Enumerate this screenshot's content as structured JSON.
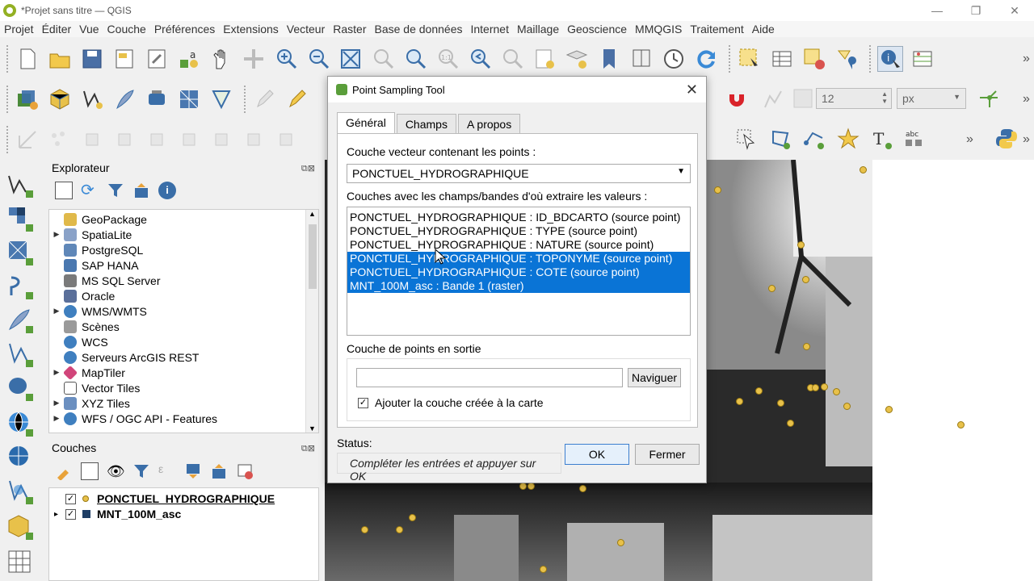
{
  "window": {
    "title": "*Projet sans titre — QGIS",
    "minimize": "—",
    "restore": "❐",
    "close": "✕"
  },
  "menu": [
    "Projet",
    "Éditer",
    "Vue",
    "Couche",
    "Préférences",
    "Extensions",
    "Vecteur",
    "Raster",
    "Base de données",
    "Internet",
    "Maillage",
    "Geoscience",
    "MMQGIS",
    "Traitement",
    "Aide"
  ],
  "toolbar": {
    "spin_value": "12",
    "unit": "px",
    "more": "»"
  },
  "explorer": {
    "title": "Explorateur",
    "items": [
      {
        "label": "GeoPackage",
        "expand": false,
        "color": "#e0b94a"
      },
      {
        "label": "SpatiaLite",
        "expand": true,
        "color": "#8aa2c8"
      },
      {
        "label": "PostgreSQL",
        "expand": false,
        "color": "#5f87b8"
      },
      {
        "label": "SAP HANA",
        "expand": false,
        "color": "#4a78b0"
      },
      {
        "label": "MS SQL Server",
        "expand": false,
        "color": "#7a7a7a"
      },
      {
        "label": "Oracle",
        "expand": false,
        "color": "#5a6f9a"
      },
      {
        "label": "WMS/WMTS",
        "expand": true,
        "color": "#3f7fbf"
      },
      {
        "label": "Scènes",
        "expand": false,
        "color": "#9a9a9a"
      },
      {
        "label": "WCS",
        "expand": false,
        "color": "#3f7fbf"
      },
      {
        "label": "Serveurs ArcGIS REST",
        "expand": false,
        "color": "#3f7fbf"
      },
      {
        "label": "MapTiler",
        "expand": true,
        "color": "#d1457a"
      },
      {
        "label": "Vector Tiles",
        "expand": false,
        "color": "#777777"
      },
      {
        "label": "XYZ Tiles",
        "expand": true,
        "color": "#6b8fc0"
      },
      {
        "label": "WFS / OGC API - Features",
        "expand": true,
        "color": "#3f7fbf"
      }
    ]
  },
  "layers": {
    "title": "Couches",
    "items": [
      {
        "label": "PONCTUEL_HYDROGRAPHIQUE",
        "checked": "✓",
        "expand": ""
      },
      {
        "label": "MNT_100M_asc",
        "checked": "✓",
        "expand": "▸"
      }
    ]
  },
  "dialog": {
    "title": "Point Sampling Tool",
    "close": "✕",
    "tabs": [
      "Général",
      "Champs",
      "A propos"
    ],
    "point_layer_label": "Couche vecteur contenant les points :",
    "point_layer_value": "PONCTUEL_HYDROGRAPHIQUE",
    "fields_label": "Couches avec les champs/bandes d'où extraire les valeurs :",
    "fields": [
      {
        "label": "PONCTUEL_HYDROGRAPHIQUE : ID_BDCARTO (source point)",
        "selected": false
      },
      {
        "label": "PONCTUEL_HYDROGRAPHIQUE : TYPE (source point)",
        "selected": false
      },
      {
        "label": "PONCTUEL_HYDROGRAPHIQUE : NATURE (source point)",
        "selected": false
      },
      {
        "label": "PONCTUEL_HYDROGRAPHIQUE : TOPONYME (source point)",
        "selected": true
      },
      {
        "label": "PONCTUEL_HYDROGRAPHIQUE : COTE (source point)",
        "selected": true
      },
      {
        "label": "MNT_100M_asc : Bande 1 (raster)",
        "selected": true
      }
    ],
    "output_label": "Couche de points en sortie",
    "output_value": "",
    "browse": "Naviguer",
    "add_layer_label": "Ajouter la couche créée à la carte",
    "add_layer_checked": "✓",
    "status_label": "Status:",
    "status_text": "Compléter les entrées et appuyer sur OK",
    "ok": "OK",
    "close_btn": "Fermer"
  },
  "colors": {
    "selection": "#0a74d6",
    "points": "#e8c14a"
  }
}
